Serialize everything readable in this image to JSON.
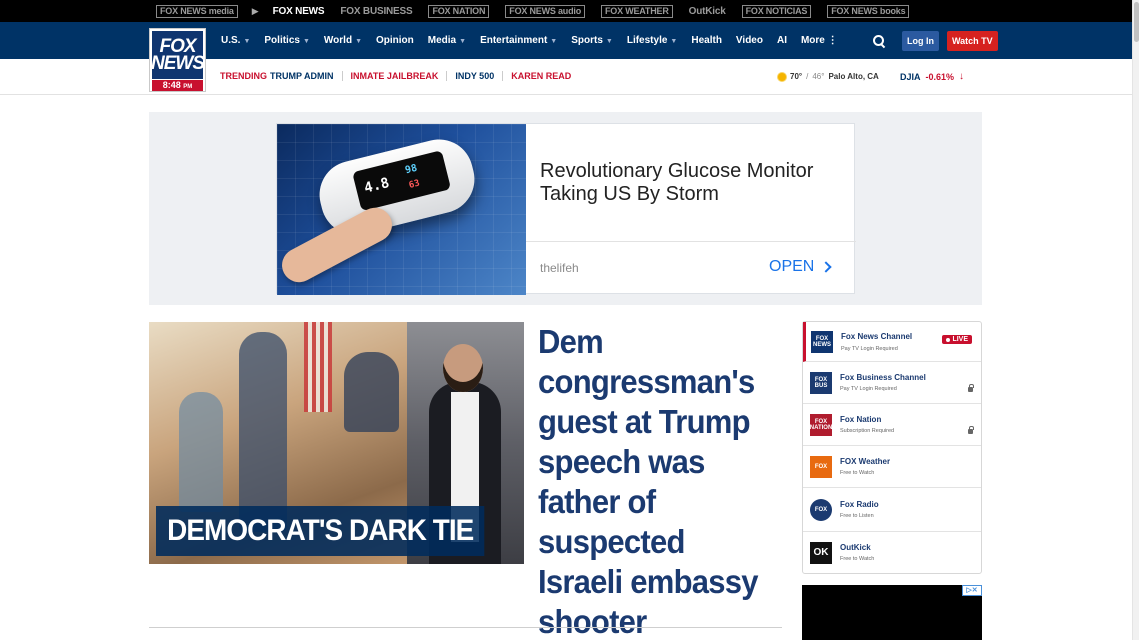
{
  "network_bar": {
    "items": [
      {
        "label": "FOX NEWS media",
        "boxed": true
      },
      {
        "label": "FOX NEWS",
        "active": true
      },
      {
        "label": "FOX BUSINESS"
      },
      {
        "label": "FOX NATION",
        "boxed": true
      },
      {
        "label": "FOX NEWS audio",
        "boxed": true
      },
      {
        "label": "FOX WEATHER",
        "boxed": true
      },
      {
        "label": "OutKick"
      },
      {
        "label": "FOX NOTICIAS",
        "boxed": true
      },
      {
        "label": "FOX NEWS books",
        "boxed": true
      }
    ],
    "arrow_icon": "play-arrow-icon"
  },
  "logo": {
    "line1": "FOX",
    "line2": "NEWS",
    "time": "8:48",
    "ampm": "PM"
  },
  "nav": {
    "items": [
      {
        "label": "U.S.",
        "dropdown": true
      },
      {
        "label": "Politics",
        "dropdown": true
      },
      {
        "label": "World",
        "dropdown": true
      },
      {
        "label": "Opinion",
        "dropdown": false
      },
      {
        "label": "Media",
        "dropdown": true
      },
      {
        "label": "Entertainment",
        "dropdown": true
      },
      {
        "label": "Sports",
        "dropdown": true
      },
      {
        "label": "Lifestyle",
        "dropdown": true
      },
      {
        "label": "Health",
        "dropdown": false
      },
      {
        "label": "Video",
        "dropdown": false
      },
      {
        "label": "AI",
        "dropdown": false
      },
      {
        "label": "More ⋮",
        "dropdown": false
      }
    ],
    "login_label": "Log In",
    "watch_label": "Watch TV",
    "colors": {
      "nav_bg": "#003366",
      "watch_bg": "#d6221f",
      "login_bg": "#2b5aa0"
    }
  },
  "trending": {
    "label": "TRENDING",
    "items": [
      "TRUMP ADMIN",
      "INMATE JAILBREAK",
      "INDY 500",
      "KAREN READ"
    ],
    "hot_items": [
      1,
      3
    ]
  },
  "weather": {
    "high": "70°",
    "sep": "/",
    "low": "46°",
    "location": "Palo Alto, CA",
    "icon": "sun-icon"
  },
  "market": {
    "index": "DJIA",
    "change": "-0.61%",
    "direction_icon": "arrow-down-icon"
  },
  "ad": {
    "headline": "Revolutionary Glucose Monitor Taking US By Storm",
    "source": "thelifeh",
    "cta": "OPEN",
    "device_readouts": [
      "4.8",
      "98",
      "63"
    ]
  },
  "hero": {
    "label": "DEMOCRAT'S DARK TIE",
    "title": "Dem congressman's guest at Trump speech was father of suspected Israeli embassy shooter"
  },
  "channels": {
    "items": [
      {
        "name": "Fox News Channel",
        "sub": "Pay TV Login Required",
        "badge": "LIVE",
        "logo": "FOX NEWS",
        "logo_color": "#0f3570"
      },
      {
        "name": "Fox Business Channel",
        "sub": "Pay TV Login Required",
        "locked": true,
        "logo": "FOX BUS",
        "logo_color": "#1b3a70"
      },
      {
        "name": "Fox Nation",
        "sub": "Subscription Required",
        "locked": true,
        "logo": "FOX NATION",
        "logo_color": "#b01c2e"
      },
      {
        "name": "FOX Weather",
        "sub": "Free to Watch",
        "logo": "FOX",
        "logo_color": "#e86a10"
      },
      {
        "name": "Fox Radio",
        "sub": "Free to Listen",
        "logo": "FOX",
        "logo_color": "#1b3a70"
      },
      {
        "name": "OutKick",
        "sub": "Free to Watch",
        "logo": "OK",
        "logo_color": "#111111"
      }
    ]
  }
}
